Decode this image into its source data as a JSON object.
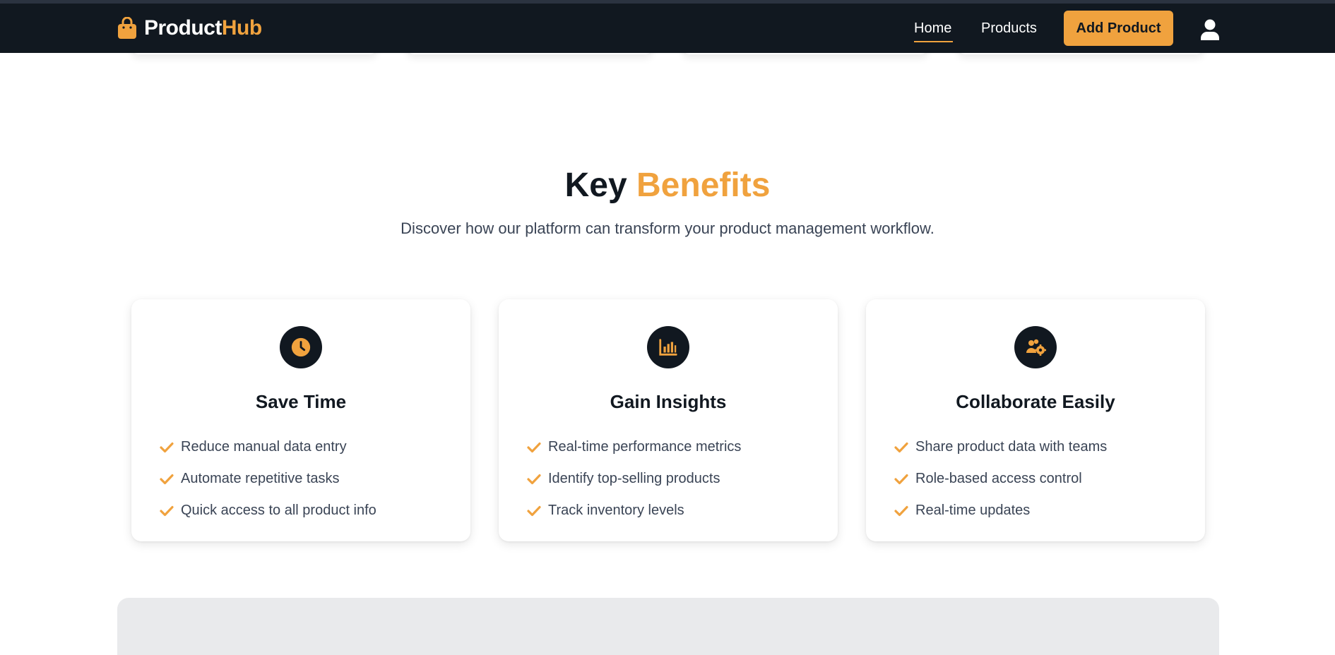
{
  "navbar": {
    "brand_part1": "Product",
    "brand_part2": "Hub",
    "links": [
      {
        "label": "Home",
        "active": true
      },
      {
        "label": "Products",
        "active": false
      }
    ],
    "cta_label": "Add Product",
    "user_icon": "user-icon"
  },
  "benefits": {
    "title_part1": "Key",
    "title_part2": "Benefits",
    "subtitle": "Discover how our platform can transform your product management workflow.",
    "cards": [
      {
        "icon": "clock-icon",
        "title": "Save Time",
        "items": [
          "Reduce manual data entry",
          "Automate repetitive tasks",
          "Quick access to all product info"
        ]
      },
      {
        "icon": "chart-bar-icon",
        "title": "Gain Insights",
        "items": [
          "Real-time performance metrics",
          "Identify top-selling products",
          "Track inventory levels"
        ]
      },
      {
        "icon": "users-cog-icon",
        "title": "Collaborate Easily",
        "items": [
          "Share product data with teams",
          "Role-based access control",
          "Real-time updates"
        ]
      }
    ]
  },
  "colors": {
    "accent": "#f0a23e",
    "dark": "#111820",
    "text_muted": "#3a4455"
  }
}
